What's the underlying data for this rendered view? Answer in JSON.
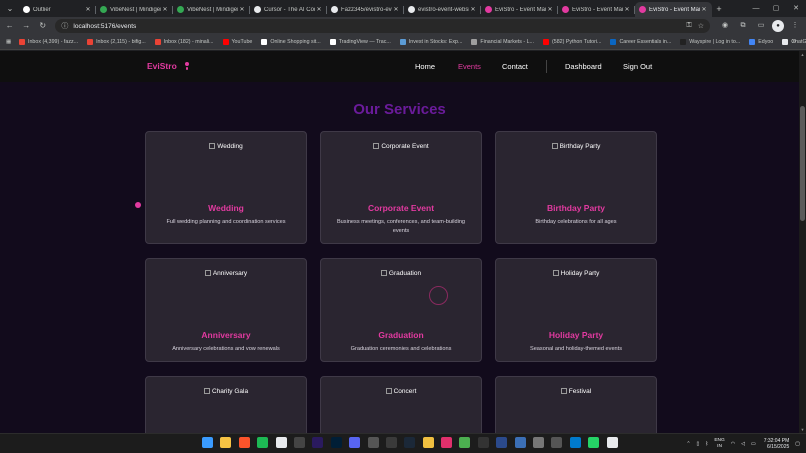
{
  "browser": {
    "tabs": [
      {
        "label": "Outlier",
        "color": "#ffffff",
        "active": false
      },
      {
        "label": "VibeNest | Mindigen...",
        "color": "#34a853",
        "active": false
      },
      {
        "label": "VibeNest | Mindigen...",
        "color": "#34a853",
        "active": false
      },
      {
        "label": "Cursor - The AI Code...",
        "color": "#e8eaed",
        "active": false
      },
      {
        "label": "Fazz345/evistro-event...",
        "color": "#e8eaed",
        "active": false
      },
      {
        "label": "evistro-event-website...",
        "color": "#e8eaed",
        "active": false
      },
      {
        "label": "EviStro - Event Mana...",
        "color": "#e23aa0",
        "active": false
      },
      {
        "label": "EviStro - Event Mana...",
        "color": "#e23aa0",
        "active": false
      },
      {
        "label": "EviStro - Event Mana...",
        "color": "#e23aa0",
        "active": true
      }
    ],
    "url": "localhost:5176/events",
    "bookmarks": [
      {
        "label": "Inbox (4,399) - fazz...",
        "color": "#ea4335"
      },
      {
        "label": "Inbox (2,115) - bifig...",
        "color": "#ea4335"
      },
      {
        "label": "Inbox (182) - minali...",
        "color": "#ea4335"
      },
      {
        "label": "YouTube",
        "color": "#ff0000"
      },
      {
        "label": "Online Shopping sit...",
        "color": "#ffffff"
      },
      {
        "label": "TradingView — Trac...",
        "color": "#ffffff"
      },
      {
        "label": "Invest in Stocks: Exp...",
        "color": "#5b9bd5"
      },
      {
        "label": "Financial Markets - L...",
        "color": "#9e9e9e"
      },
      {
        "label": "(582) Python Tutori...",
        "color": "#ff0000"
      },
      {
        "label": "Career Essentials in...",
        "color": "#0a66c2"
      },
      {
        "label": "Wayspire | Log in to...",
        "color": "#222222"
      },
      {
        "label": "Edyoo",
        "color": "#4285f4"
      },
      {
        "label": "ChatGPT",
        "color": "#e8eaed"
      }
    ]
  },
  "site": {
    "brand": "EviStro",
    "nav": {
      "home": "Home",
      "events": "Events",
      "contact": "Contact",
      "dashboard": "Dashboard",
      "signout": "Sign Out"
    },
    "section_title": "Our Services",
    "accent": "#e23aa0",
    "title_color": "#6a1b9a",
    "services": [
      {
        "alt": "Wedding",
        "title": "Wedding",
        "description": "Full wedding planning and coordination services"
      },
      {
        "alt": "Corporate Event",
        "title": "Corporate Event",
        "description": "Business meetings, conferences, and team-building events"
      },
      {
        "alt": "Birthday Party",
        "title": "Birthday Party",
        "description": "Birthday celebrations for all ages"
      },
      {
        "alt": "Anniversary",
        "title": "Anniversary",
        "description": "Anniversary celebrations and vow renewals"
      },
      {
        "alt": "Graduation",
        "title": "Graduation",
        "description": "Graduation ceremonies and celebrations"
      },
      {
        "alt": "Holiday Party",
        "title": "Holiday Party",
        "description": "Seasonal and holiday-themed events"
      },
      {
        "alt": "Charity Gala",
        "title": "",
        "description": ""
      },
      {
        "alt": "Concert",
        "title": "",
        "description": ""
      },
      {
        "alt": "Festival",
        "title": "",
        "description": ""
      }
    ]
  },
  "taskbar": {
    "apps": [
      {
        "name": "windows-start-icon",
        "color": "#3a9bff"
      },
      {
        "name": "file-explorer-icon",
        "color": "#f6c344"
      },
      {
        "name": "brave-icon",
        "color": "#fb542b"
      },
      {
        "name": "spotify-icon",
        "color": "#1db954"
      },
      {
        "name": "chrome-icon",
        "color": "#e8eaed"
      },
      {
        "name": "obs-icon",
        "color": "#444444"
      },
      {
        "name": "premiere-icon",
        "color": "#2a1a5e"
      },
      {
        "name": "photoshop-icon",
        "color": "#001e36"
      },
      {
        "name": "discord-icon",
        "color": "#5865f2"
      },
      {
        "name": "app-icon",
        "color": "#555555"
      },
      {
        "name": "store-icon",
        "color": "#3a3a3a"
      },
      {
        "name": "steam-icon",
        "color": "#1b2838"
      },
      {
        "name": "photos-icon",
        "color": "#f0c040"
      },
      {
        "name": "instagram-icon",
        "color": "#e1306c"
      },
      {
        "name": "vpn-icon",
        "color": "#4caf50"
      },
      {
        "name": "terminal-icon",
        "color": "#333333"
      },
      {
        "name": "app2-icon",
        "color": "#2b4a8c"
      },
      {
        "name": "app3-icon",
        "color": "#3b6fb6"
      },
      {
        "name": "app4-icon",
        "color": "#777777"
      },
      {
        "name": "app5-icon",
        "color": "#555555"
      },
      {
        "name": "vscode-icon",
        "color": "#007acc"
      },
      {
        "name": "whatsapp-icon",
        "color": "#25d366"
      },
      {
        "name": "chrome-active-icon",
        "color": "#e8eaed"
      }
    ],
    "lang_top": "ENG",
    "lang_bottom": "IN",
    "time": "7:32:04 PM",
    "date": "6/15/2025"
  }
}
